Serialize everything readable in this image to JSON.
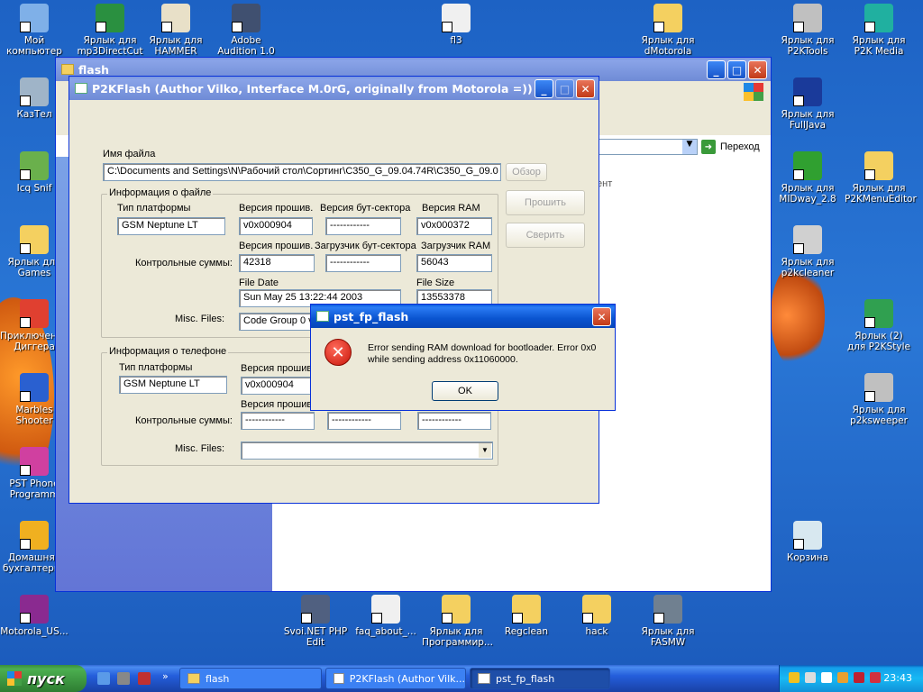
{
  "desktop": {
    "icons_left": [
      {
        "label": "Мой компьютер",
        "color": "#7fb0e8"
      },
      {
        "label": "КазТел",
        "color": "#9fb4c8"
      },
      {
        "label": "Icq Snif",
        "color": "#6ab04c"
      },
      {
        "label": "Ярлык для Games",
        "color": "#f4d060"
      },
      {
        "label": "Приключения Диггера",
        "color": "#e04030"
      },
      {
        "label": "Marbles Shooter",
        "color": "#2a60d0"
      },
      {
        "label": "PST Phone Programm",
        "color": "#d040a0"
      },
      {
        "label": "Домашняя бухгалтерия",
        "color": "#f0b020"
      },
      {
        "label": "Motorola_US...",
        "color": "#8a2a90"
      }
    ],
    "icons_top": [
      {
        "label": "Ярлык для mp3DirectCut",
        "color": "#2a9040"
      },
      {
        "label": "Ярлык для HAMMER",
        "color": "#e8e0c8"
      },
      {
        "label": "Adobe Audition 1.0",
        "color": "#405070"
      },
      {
        "label": "fl3",
        "color": "#f0f0f0"
      },
      {
        "label": "Ярлык для dMotorola",
        "color": "#f4d060"
      },
      {
        "label": "Ярлык для P2KTools",
        "color": "#c0c0c0"
      },
      {
        "label": "Ярлык для P2K Media",
        "color": "#20b0a0"
      }
    ],
    "icons_right": [
      {
        "label": "Ярлык для FullJava",
        "color": "#1a3a9a"
      },
      {
        "label": "Ярлык для MIDway_2.8",
        "color": "#30a030"
      },
      {
        "label": "Ярлык для P2KMenuEditor",
        "color": "#f4d060"
      },
      {
        "label": "Ярлык для p2kcleaner",
        "color": "#d0d0d0"
      },
      {
        "label": "Ярлык (2) для P2KStyle",
        "color": "#30a050"
      },
      {
        "label": "Ярлык для p2ksweeper",
        "color": "#c0c0c0"
      },
      {
        "label": "Корзина",
        "color": "#d8e8f0"
      }
    ],
    "icons_bottom": [
      {
        "label": "Svoi.NET PHP Edit",
        "color": "#506080"
      },
      {
        "label": "faq_about_...",
        "color": "#f0f0f0"
      },
      {
        "label": "Ярлык для Программир...",
        "color": "#f4d060"
      },
      {
        "label": "Regclean",
        "color": "#f4d060"
      },
      {
        "label": "hack",
        "color": "#f4d060"
      },
      {
        "label": "Ярлык для FASMW",
        "color": "#708090"
      }
    ]
  },
  "explorer": {
    "title": "flash",
    "go_label": "Переход",
    "content_text": "ент"
  },
  "p2kflash": {
    "title": "P2KFlash (Author Vilko, Interface M.0rG, originally from Motorola =))",
    "file_label": "Имя файла",
    "file_path": "C:\\Documents and Settings\\N\\Рабочий стол\\Сортинг\\C350_G_09.04.74R\\C350_G_09.0",
    "browse_button": "Обзор",
    "flash_button": "Прошить",
    "verify_button": "Сверить",
    "file_info": {
      "group_title": "Информация о файле",
      "platform_label": "Тип платформы",
      "platform_value": "GSM Neptune LT",
      "fw_ver_label": "Версия прошив.",
      "fw_ver_value": "v0x000904",
      "boot_ver_label": "Версия бут-сектора",
      "boot_ver_value": "------------",
      "ram_ver_label": "Версия RAM",
      "ram_ver_value": "v0x000372",
      "checksum_label": "Контрольные суммы:",
      "fw_cs_label": "Версия прошив.",
      "fw_cs_value": "42318",
      "boot_loader_label": "Загрузчик бут-сектора",
      "boot_loader_value": "------------",
      "ram_loader_label": "Загрузчик RAM",
      "ram_loader_value": "56043",
      "file_date_label": "File Date",
      "file_date_value": "Sun May 25 13:22:44 2003",
      "file_size_label": "File Size",
      "file_size_value": "13553378",
      "misc_label": "Misc. Files:",
      "misc_value": "Code Group 0 v"
    },
    "phone_info": {
      "group_title": "Информация о телефоне",
      "platform_label": "Тип платформы",
      "platform_value": "GSM Neptune LT",
      "fw_ver_label": "Версия прошив",
      "fw_ver_value": "v0x000904",
      "fw_cs_label": "Версия прошив",
      "checksum_label": "Контрольные суммы:",
      "cs1": "------------",
      "cs2": "------------",
      "cs3": "------------",
      "misc_label": "Misc. Files:",
      "misc_value": ""
    }
  },
  "dialog": {
    "title": "pst_fp_flash",
    "message": "Error sending RAM download for bootloader. Error 0x0 while sending address 0x11060000.",
    "ok_button": "OK"
  },
  "taskbar": {
    "start_label": "пуск",
    "tasks": [
      {
        "label": "flash"
      },
      {
        "label": "P2KFlash (Author Vilk..."
      },
      {
        "label": "pst_fp_flash"
      }
    ],
    "clock": "23:43"
  }
}
